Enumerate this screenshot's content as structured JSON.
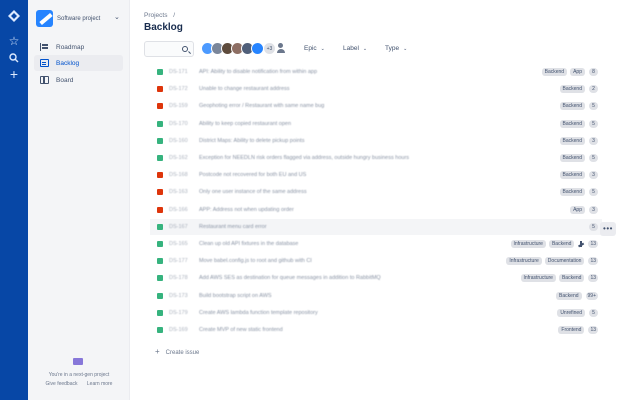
{
  "global_nav": {
    "icons": [
      "jira-logo-icon",
      "star-icon",
      "search-icon",
      "plus-icon"
    ]
  },
  "sidebar": {
    "project_name": "Software project",
    "items": [
      {
        "label": "Roadmap",
        "icon": "roadmap-icon",
        "active": false
      },
      {
        "label": "Backlog",
        "icon": "backlog-icon",
        "active": true
      },
      {
        "label": "Board",
        "icon": "board-icon",
        "active": false
      }
    ],
    "footer_text": "You're in a next-gen project",
    "give_feedback": "Give feedback",
    "learn_more": "Learn more"
  },
  "header": {
    "breadcrumb": "Projects",
    "breadcrumb_sep": "/",
    "title": "Backlog"
  },
  "filters": {
    "avatars_more": "+3",
    "epic": "Epic",
    "label": "Label",
    "type": "Type"
  },
  "issues": [
    {
      "type": "story",
      "key": "DS-171",
      "summary": "API: Ability to disable notification from within app",
      "labels": [
        "Backend",
        "App"
      ],
      "estimate": "8"
    },
    {
      "type": "bug",
      "key": "DS-172",
      "summary": "Unable to change restaurant address",
      "labels": [
        "Backend"
      ],
      "estimate": "2"
    },
    {
      "type": "bug",
      "key": "DS-159",
      "summary": "Geophoting error / Restaurant with same name bug",
      "labels": [
        "Backend"
      ],
      "estimate": "5"
    },
    {
      "type": "story",
      "key": "DS-170",
      "summary": "Ability to keep copied restaurant open",
      "labels": [
        "Backend"
      ],
      "estimate": "5"
    },
    {
      "type": "story",
      "key": "DS-160",
      "summary": "District Maps: Ability to delete pickup points",
      "labels": [
        "Backend"
      ],
      "estimate": "3"
    },
    {
      "type": "story",
      "key": "DS-162",
      "summary": "Exception for NEEDLN risk orders flagged via address, outside hungry business hours",
      "labels": [
        "Backend"
      ],
      "estimate": "5"
    },
    {
      "type": "bug",
      "key": "DS-168",
      "summary": "Postcode not recovered for both EU and US",
      "labels": [
        "Backend"
      ],
      "estimate": "3"
    },
    {
      "type": "bug",
      "key": "DS-163",
      "summary": "Only one user instance of the same address",
      "labels": [
        "Backend"
      ],
      "estimate": "5"
    },
    {
      "type": "bug",
      "key": "DS-166",
      "summary": "APP: Address not when updating order",
      "labels": [
        "App"
      ],
      "estimate": "3"
    },
    {
      "type": "story",
      "key": "DS-167",
      "summary": "Restaurant menu card error",
      "labels": [],
      "estimate": "5",
      "hover": true
    },
    {
      "type": "story",
      "key": "DS-165",
      "summary": "Clean up old API fixtures in the database",
      "labels": [
        "Infrastructure",
        "Backend"
      ],
      "estimate": "13",
      "branch": true
    },
    {
      "type": "story",
      "key": "DS-177",
      "summary": "Move babel.config.js to root and github with CI",
      "labels": [
        "Infrastructure",
        "Documentation"
      ],
      "estimate": "13"
    },
    {
      "type": "story",
      "key": "DS-178",
      "summary": "Add AWS SES as destination for queue messages in addition to RabbitMQ",
      "labels": [
        "Infrastructure",
        "Backend"
      ],
      "estimate": "13"
    },
    {
      "type": "story",
      "key": "DS-173",
      "summary": "Build bootstrap script on AWS",
      "labels": [
        "Backend"
      ],
      "estimate": "99+"
    },
    {
      "type": "story",
      "key": "DS-179",
      "summary": "Create AWS lambda function template repository",
      "labels": [
        "Unrefined"
      ],
      "estimate": "5"
    },
    {
      "type": "story",
      "key": "DS-169",
      "summary": "Create MVP of new static frontend",
      "labels": [
        "Frontend"
      ],
      "estimate": "13"
    }
  ],
  "more_actions": "•••",
  "create_issue": "Create issue",
  "colors": {
    "nav": "#0747a6",
    "sidebar": "#f4f5f7",
    "story": "#36b37e",
    "bug": "#de350b",
    "accent": "#0052cc"
  }
}
